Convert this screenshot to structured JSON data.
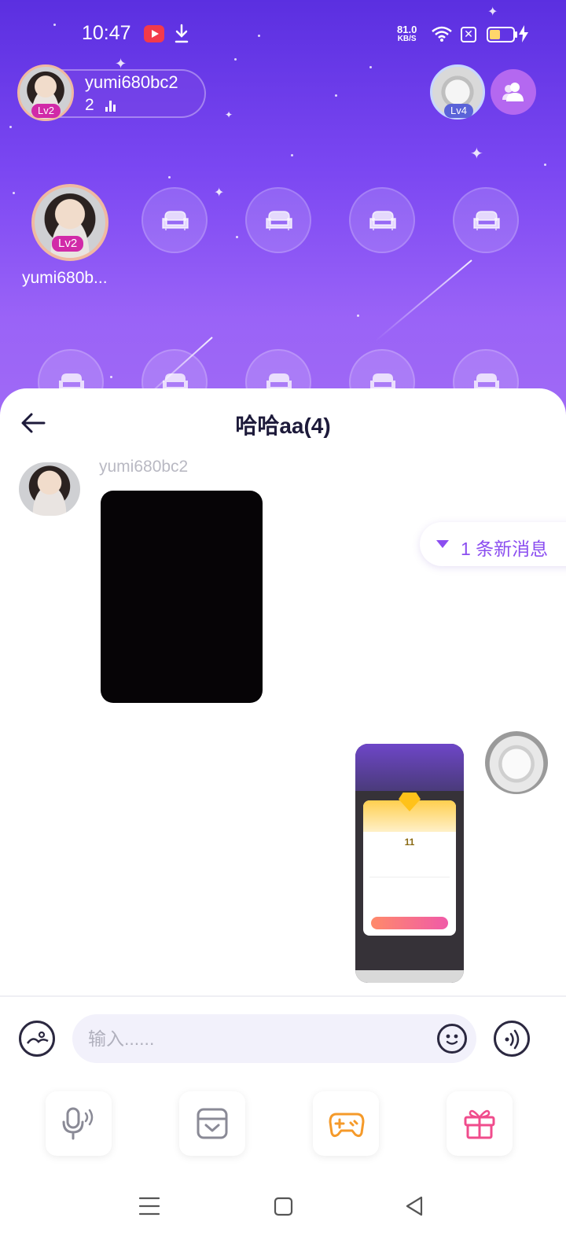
{
  "status_bar": {
    "time": "10:47",
    "net_speed_value": "81.0",
    "net_speed_unit": "KB/S",
    "sim_label": "✕",
    "battery_level": 0.45,
    "icons": [
      "youtube-icon",
      "download-icon",
      "wifi-icon",
      "sim-icon",
      "battery-icon",
      "charging-icon"
    ]
  },
  "room": {
    "host": {
      "name": "yumi680bc2",
      "count": "2",
      "level": "Lv2"
    },
    "owner": {
      "level": "Lv4"
    },
    "seat_1": {
      "name": "yumi680b...",
      "level": "Lv2"
    },
    "empty_seat_icon": "sofa-icon"
  },
  "chat": {
    "title": "哈哈aa(4)",
    "messages": [
      {
        "side": "left",
        "sender": "yumi680bc2",
        "type": "image"
      },
      {
        "side": "right",
        "type": "image",
        "thumb_value": "11"
      }
    ],
    "new_message_notice": "1 条新消息"
  },
  "input": {
    "placeholder": "输入......"
  },
  "tools": [
    {
      "name": "voice-tool",
      "icon": "mic-icon"
    },
    {
      "name": "album-tool",
      "icon": "album-icon"
    },
    {
      "name": "game-tool",
      "icon": "gamepad-icon"
    },
    {
      "name": "gift-tool",
      "icon": "gift-icon"
    }
  ],
  "colors": {
    "room_top": "#5b2fe0",
    "room_bottom": "#a06af5",
    "accent": "#8b4ef0",
    "level_badge": "#d12aa8",
    "text_dark": "#1d1a3a"
  }
}
